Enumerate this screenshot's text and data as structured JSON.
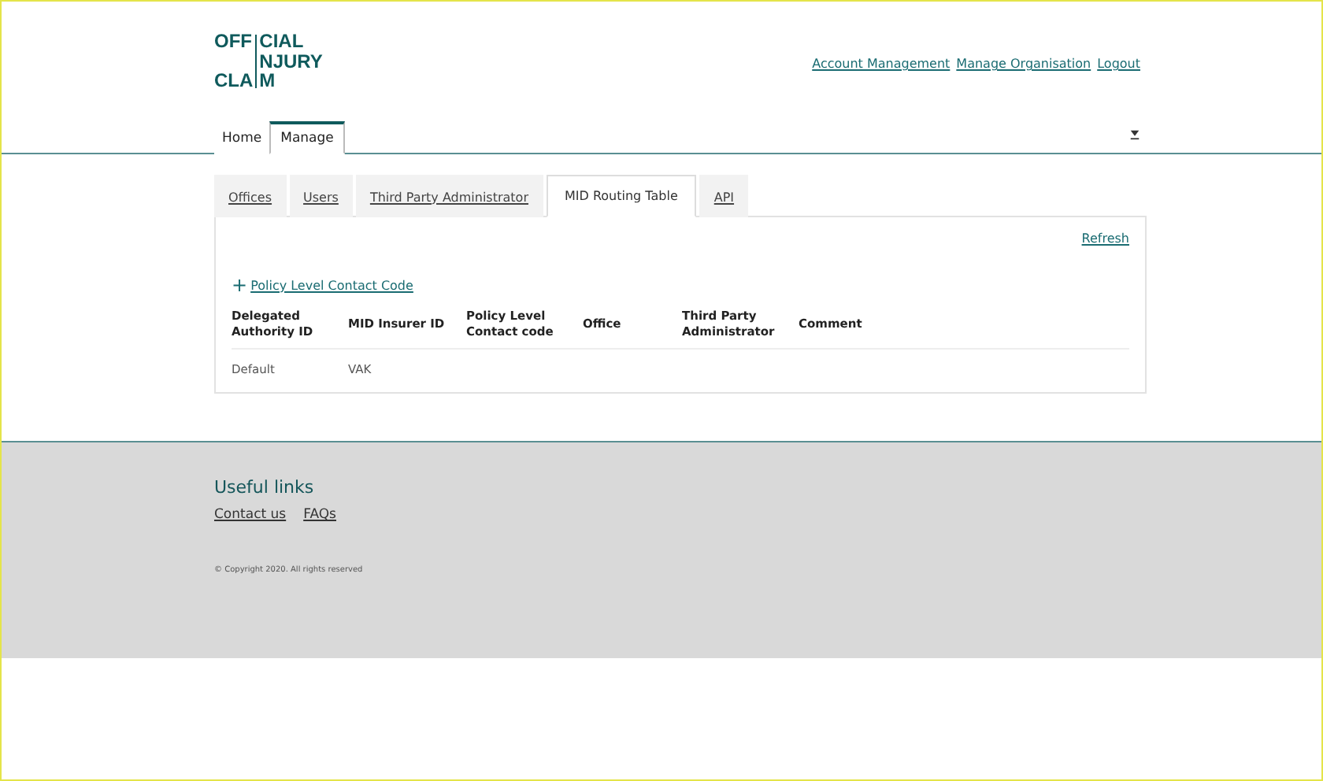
{
  "logo": {
    "lines": [
      {
        "before": "OFF",
        "after": "CIAL"
      },
      {
        "after": "NJURY"
      },
      {
        "before": "CLA",
        "after": "M"
      }
    ]
  },
  "header_links": [
    "Account Management",
    "Manage Organisation",
    "Logout"
  ],
  "main_tabs": [
    {
      "label": "Home",
      "selected": false
    },
    {
      "label": "Manage",
      "selected": true
    }
  ],
  "sub_tabs": [
    {
      "label": "Offices",
      "selected": false
    },
    {
      "label": "Users",
      "selected": false
    },
    {
      "label": "Third Party Administrator",
      "selected": false
    },
    {
      "label": "MID Routing Table",
      "selected": true
    },
    {
      "label": "API",
      "selected": false
    }
  ],
  "panel": {
    "refresh": "Refresh",
    "add_icon": "+",
    "add_link": "Policy Level Contact Code",
    "table": {
      "columns": [
        "Delegated Authority ID",
        "MID Insurer ID",
        "Policy Level Contact code",
        "Office",
        "Third Party Administrator",
        "Comment"
      ],
      "rows": [
        [
          "Default",
          "VAK"
        ]
      ]
    }
  },
  "footer": {
    "heading": "Useful links",
    "links": [
      "Contact us",
      "FAQs"
    ],
    "copyright": "© Copyright 2020. All rights reserved"
  }
}
